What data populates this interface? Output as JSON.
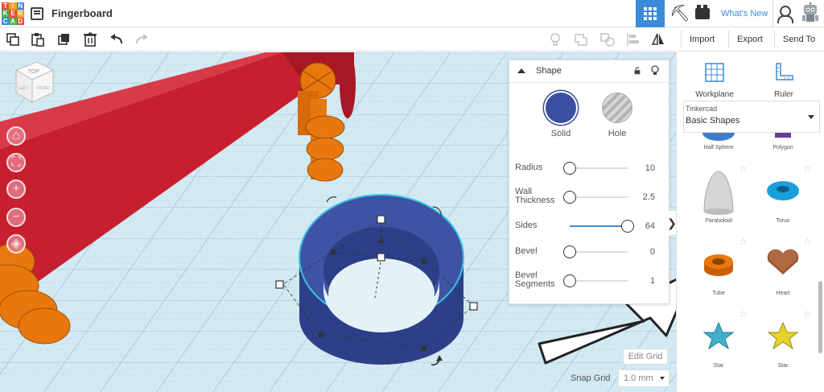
{
  "app": {
    "logo_letters": [
      "T",
      "I",
      "N",
      "K",
      "E",
      "R",
      "C",
      "A",
      "D"
    ],
    "logo_colors": [
      "#e94e3d",
      "#f6a21e",
      "#3c8bd9",
      "#48b04c",
      "#e94e3d",
      "#f6a21e",
      "#3c8bd9",
      "#48b04c",
      "#e94e3d"
    ],
    "document_title": "Fingerboard",
    "whats_new": "What's New",
    "accent": "#3c8bd9"
  },
  "toolbar": {
    "import": "Import",
    "export": "Export",
    "send_to": "Send To"
  },
  "view_cube": {
    "top": "TOP",
    "front": "FRONT",
    "left": "LEFT"
  },
  "shape_panel": {
    "title": "Shape",
    "modes": [
      {
        "label": "Solid",
        "color": "#3a4fa0",
        "selected": true
      },
      {
        "label": "Hole",
        "color": "#c2c2c2",
        "selected": false
      }
    ],
    "properties": [
      {
        "label": "Radius",
        "value": "10",
        "level": 0.0
      },
      {
        "label": "Wall Thickness",
        "value": "2.5",
        "level": 0.0
      },
      {
        "label": "Sides",
        "value": "64",
        "level": 1.0
      },
      {
        "label": "Bevel",
        "value": "0",
        "level": 0.0
      },
      {
        "label": "Bevel Segments",
        "value": "1",
        "level": 0.0
      }
    ]
  },
  "grid_controls": {
    "edit_grid": "Edit Grid",
    "snap_grid_label": "Snap Grid",
    "snap_grid_value": "1.0 mm"
  },
  "right_panel": {
    "workplane": "Workplane",
    "ruler": "Ruler",
    "library_category": "Tinkercad",
    "library_name": "Basic Shapes",
    "shapes": [
      {
        "name": "Half Sphere"
      },
      {
        "name": "Polygon"
      },
      {
        "name": "Paraboloid"
      },
      {
        "name": "Torus"
      },
      {
        "name": "Tube"
      },
      {
        "name": "Heart"
      },
      {
        "name": "Star"
      },
      {
        "name": "Star"
      }
    ]
  },
  "colors": {
    "red_block": "#c6202e",
    "orange_peg": "#e8780e",
    "tube_blue": "#3a4fa0",
    "grid_bg": "#cfe6f0"
  }
}
